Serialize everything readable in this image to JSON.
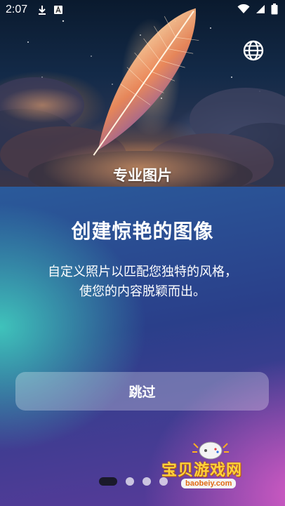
{
  "status_bar": {
    "time": "2:07",
    "left_icons": [
      "download-icon",
      "a-badge-icon"
    ],
    "right_icons": [
      "wifi-icon",
      "cellular-signal-icon",
      "battery-icon"
    ]
  },
  "hero": {
    "title": "专业图片",
    "language_button_icon": "globe-icon"
  },
  "content": {
    "heading": "创建惊艳的图像",
    "description_line1": "自定义照片以匹配您独特的风格，",
    "description_line2": "使您的内容脱颖而出。",
    "skip_label": "跳过"
  },
  "pager": {
    "total_pages": 4,
    "current_page": 1
  },
  "watermark": {
    "text": "宝贝游戏网",
    "url": "baobeiy.com"
  },
  "colors": {
    "panel_teal": "#3fc3bb",
    "panel_blue": "#2a3f8a",
    "panel_pink": "#d35bc4",
    "active_dot": "#1a1a2a"
  }
}
